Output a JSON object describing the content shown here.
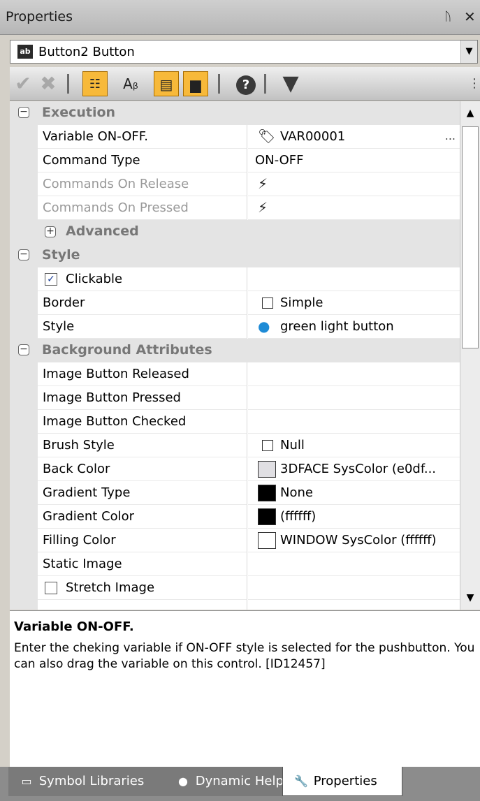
{
  "window": {
    "title": "Properties",
    "pin_icon": "pin-icon",
    "close_icon": "close-icon"
  },
  "object_selector": {
    "tag": "ab",
    "value": "Button2 Button"
  },
  "toolbar": {
    "items": [
      "check-icon",
      "delete-icon",
      "categorized-icon",
      "alphabetical-icon",
      "properties-icon",
      "events-icon",
      "help-icon",
      "filter-icon"
    ],
    "help_glyph": "?"
  },
  "grid": {
    "execution": {
      "label": "Execution",
      "toggle": "⊟"
    },
    "rows_execution": [
      {
        "name": "Variable ON-OFF.",
        "value": "VAR00001",
        "ellipsis": "..."
      },
      {
        "name": "Command Type",
        "value": "ON-OFF"
      },
      {
        "name": "Commands On Release",
        "value": ""
      },
      {
        "name": "Commands On Pressed",
        "value": ""
      }
    ],
    "advanced": {
      "label": "Advanced",
      "toggle": "⊞"
    },
    "style": {
      "label": "Style",
      "toggle": "⊟"
    },
    "clickable": {
      "label": "Clickable",
      "checked": true,
      "mark": "✓"
    },
    "border": {
      "name": "Border",
      "value": "Simple"
    },
    "style_row": {
      "name": "Style",
      "value": "green light button"
    },
    "background": {
      "label": "Background Attributes",
      "toggle": "⊟"
    },
    "rows_background": [
      {
        "name": "Image Button Released",
        "value": ""
      },
      {
        "name": "Image Button Pressed",
        "value": ""
      },
      {
        "name": "Image Button Checked",
        "value": ""
      },
      {
        "name": "Brush Style",
        "value": "Null",
        "swatch": "#ffffff"
      },
      {
        "name": "Back Color",
        "value": "3DFACE SysColor (e0df...",
        "swatch": "#e0dfe3"
      },
      {
        "name": "Gradient Type",
        "value": "None",
        "swatch": "#000000"
      },
      {
        "name": "Gradient Color",
        "value": "(ffffff)",
        "swatch": "#000000"
      },
      {
        "name": "Filling Color",
        "value": "WINDOW SysColor (ffffff)",
        "swatch": "#ffffff"
      },
      {
        "name": "Static Image",
        "value": ""
      }
    ],
    "stretch_image": {
      "label": "Stretch Image",
      "checked": false
    }
  },
  "help": {
    "title": "Variable ON-OFF.",
    "text": "Enter the cheking variable if ON-OFF style is selected for the pushbutton. You can also drag the variable on this control. [ID12457]"
  },
  "tabs": [
    {
      "label": "Symbol Libraries",
      "icon": "library-icon",
      "active": false
    },
    {
      "label": "Dynamic Help",
      "icon": "help-circle-icon",
      "active": false
    },
    {
      "label": "Properties",
      "icon": "wrench-icon",
      "active": true
    }
  ]
}
